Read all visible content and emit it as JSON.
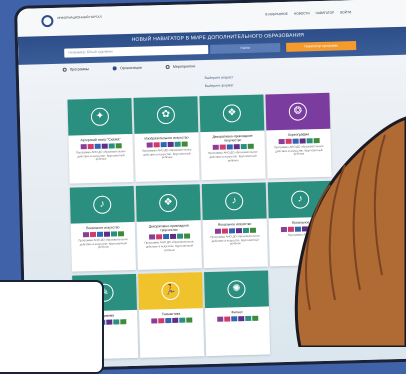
{
  "topbar": {
    "logo_text": "ИНФОРМАЦИОННЫЙ ПОРТАЛ",
    "nav": [
      "В ИЗБРАННОЕ",
      "НОВОСТИ",
      "НАВИГАТОР",
      "ВОЙТИ"
    ]
  },
  "hero": {
    "title": "НОВЫЙ НАВИГАТОР В МИРЕ ДОПОЛНИТЕЛЬНОГО ОБРАЗОВАНИЯ",
    "search_placeholder": "Например: Юный художник",
    "search_button": "Найти",
    "navigator_button": "Навигатор программ"
  },
  "filters": [
    {
      "label": "Программы",
      "selected": false
    },
    {
      "label": "Организации",
      "selected": true
    },
    {
      "label": "Мероприятия",
      "selected": false
    }
  ],
  "sort": {
    "line1": "Выберите возраст",
    "line2": "Выберите формат"
  },
  "cards": [
    {
      "title": "Авторский театр \"Сказка\"",
      "text": "Программа АНО ДО образовательное действие в искусстве. Кругосветный ребёнок",
      "color": "#2a8f7f",
      "icon": "theater-icon",
      "glyph": "✦"
    },
    {
      "title": "Изобразительное искусство",
      "text": "Программа АНО ДО образовательное действие в искусстве. Кругосветный ребёнок",
      "color": "#2a8f7f",
      "icon": "palette-icon",
      "glyph": "✿"
    },
    {
      "title": "Декоративно-прикладное творчество",
      "text": "Программа АНО ДО образовательное действие в искусстве. Кругосветный ребёнок",
      "color": "#2a8f7f",
      "icon": "craft-icon",
      "glyph": "❖"
    },
    {
      "title": "Хореография",
      "text": "Программа АНО ДО образовательное действие в искусстве. Кругосветный ребёнок",
      "color": "#7a3c9e",
      "icon": "dance-icon",
      "glyph": "❂"
    },
    {
      "title": "Вокальное искусство",
      "text": "Программа АНО ДО образовательное действие в искусстве. Кругосветный ребёнок",
      "color": "#2a8f7f",
      "icon": "music-icon",
      "glyph": "♪"
    },
    {
      "title": "Декоративно-прикладное творчество",
      "text": "Программа АНО ДО образовательное действие в искусстве. Кругосветный ребёнок",
      "color": "#2a8f7f",
      "icon": "craft-icon",
      "glyph": "❖"
    },
    {
      "title": "Вокальное искусство",
      "text": "Программа АНО ДО образовательное действие в искусстве. Кругосветный ребёнок",
      "color": "#2a8f7f",
      "icon": "music-icon",
      "glyph": "♪"
    },
    {
      "title": "Вокальное",
      "text": "Программа АНО ДО",
      "color": "#2a8f7f",
      "icon": "music-icon",
      "glyph": "♪"
    },
    {
      "title": "Программа",
      "text": "",
      "color": "#2a8f7f",
      "icon": "paint-icon",
      "glyph": "✎"
    },
    {
      "title": "Гимнастика",
      "text": "",
      "color": "#f0c22b",
      "icon": "runner-icon",
      "glyph": "🏃"
    },
    {
      "title": "Фитнес",
      "text": "",
      "color": "#2a8f7f",
      "icon": "sport-icon",
      "glyph": "✺"
    }
  ]
}
